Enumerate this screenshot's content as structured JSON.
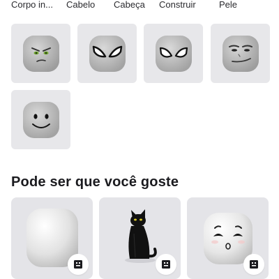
{
  "tabs": [
    {
      "label": "Corpo in..."
    },
    {
      "label": "Cabelo"
    },
    {
      "label": "Cabeça"
    },
    {
      "label": "Construir"
    },
    {
      "label": "Pele"
    }
  ],
  "faces": [
    {
      "icon": "angry-face-icon"
    },
    {
      "icon": "spider-mask-face-icon"
    },
    {
      "icon": "spider-mask-face-icon"
    },
    {
      "icon": "smug-face-icon"
    },
    {
      "icon": "smile-face-icon"
    }
  ],
  "section": {
    "title": "Pode ser que você goste"
  },
  "recommendations": [
    {
      "icon": "blank-head-icon",
      "action_icon": "try-on-icon"
    },
    {
      "icon": "black-cat-icon",
      "action_icon": "try-on-icon"
    },
    {
      "icon": "cute-face-head-icon",
      "action_icon": "try-on-icon"
    }
  ],
  "colors": {
    "tile": "#e7e7ea",
    "text": "#1b1b1f"
  }
}
